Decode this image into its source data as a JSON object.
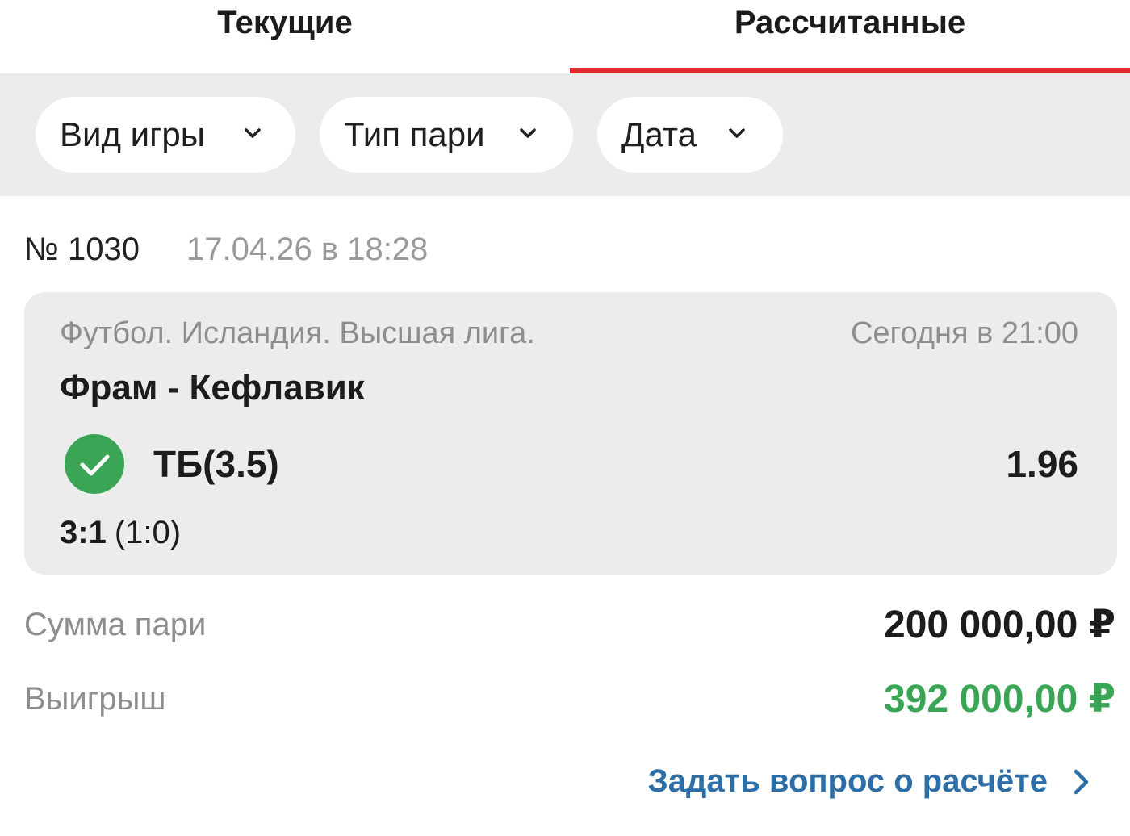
{
  "tabs": {
    "current": "Текущие",
    "settled": "Рассчитанные"
  },
  "filters": {
    "game_type": "Вид игры",
    "bet_type": "Тип пари",
    "date": "Дата"
  },
  "bet": {
    "number": "№ 1030",
    "date": "17.04.26 в 18:28"
  },
  "event": {
    "league": "Футбол. Исландия. Высшая лига.",
    "time": "Сегодня в 21:00",
    "teams": "Фрам - Кефлавик",
    "outcome": "ТБ(3.5)",
    "odds": "1.96",
    "score_main": "3:1",
    "score_half": "(1:0)",
    "status_icon": "check-circle-icon"
  },
  "summary": {
    "stake_label": "Сумма пари",
    "stake_value": "200 000,00 ₽",
    "win_label": "Выигрыш",
    "win_value": "392 000,00 ₽"
  },
  "actions": {
    "ask_label": "Задать вопрос о расчёте"
  },
  "colors": {
    "accent_red": "#e0282e",
    "win_green": "#3aa655",
    "link_blue": "#2c6fa8",
    "card_bg": "#ececec"
  }
}
